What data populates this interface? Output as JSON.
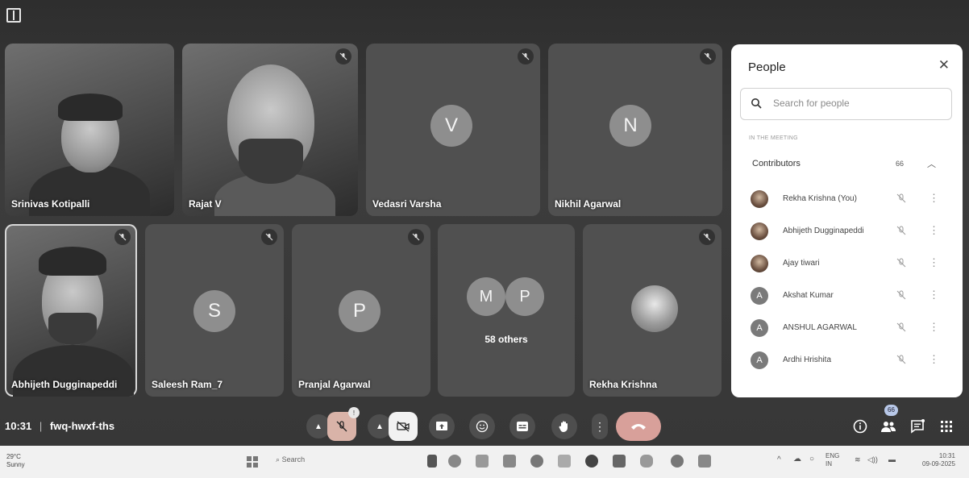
{
  "meeting": {
    "time": "10:31",
    "separator": "|",
    "code": "fwq-hwxf-ths"
  },
  "tiles": [
    {
      "name": "Srinivas Kotipalli",
      "type": "video",
      "muted": false
    },
    {
      "name": "Rajat V",
      "type": "video",
      "muted": true
    },
    {
      "name": "Vedasri Varsha",
      "type": "avatar",
      "initial": "V",
      "muted": true
    },
    {
      "name": "Nikhil Agarwal",
      "type": "avatar",
      "initial": "N",
      "muted": true
    },
    {
      "name": "Abhijeth Dugginapeddi",
      "type": "video",
      "muted": true
    },
    {
      "name": "Saleesh Ram_7",
      "type": "avatar",
      "initial": "S",
      "muted": true
    },
    {
      "name": "Pranjal Agarwal",
      "type": "avatar",
      "initial": "P",
      "muted": true
    },
    {
      "name": "",
      "type": "others",
      "initials": [
        "M",
        "P"
      ],
      "label": "58 others"
    },
    {
      "name": "Rekha Krishna",
      "type": "photo",
      "muted": true
    }
  ],
  "people_panel": {
    "title": "People",
    "search_placeholder": "Search for people",
    "section_label": "IN THE MEETING",
    "group_label": "Contributors",
    "group_count": "66",
    "participants": [
      {
        "name": "Rekha Krishna (You)",
        "avatar": "photo",
        "initial": ""
      },
      {
        "name": "Abhijeth Dugginapeddi",
        "avatar": "photo",
        "initial": ""
      },
      {
        "name": "Ajay tiwari",
        "avatar": "photo",
        "initial": ""
      },
      {
        "name": "Akshat Kumar",
        "avatar": "letter",
        "initial": "A"
      },
      {
        "name": "ANSHUL AGARWAL",
        "avatar": "letter",
        "initial": "A"
      },
      {
        "name": "Ardhi Hrishita",
        "avatar": "letter",
        "initial": "A"
      }
    ]
  },
  "controls": {
    "mic_badge": "!",
    "people_count": "66"
  },
  "taskbar": {
    "weather_temp": "29°C",
    "weather_desc": "Sunny",
    "search_label": "Search",
    "lang_top": "ENG",
    "lang_bottom": "IN",
    "clock_time": "10:31",
    "clock_date": "09-09-2025"
  },
  "colors": {
    "panel_bg": "#ffffff",
    "tile_bg": "#505050",
    "avatar_bg": "#8e8e8e",
    "leave_button": "#d8a09a"
  }
}
